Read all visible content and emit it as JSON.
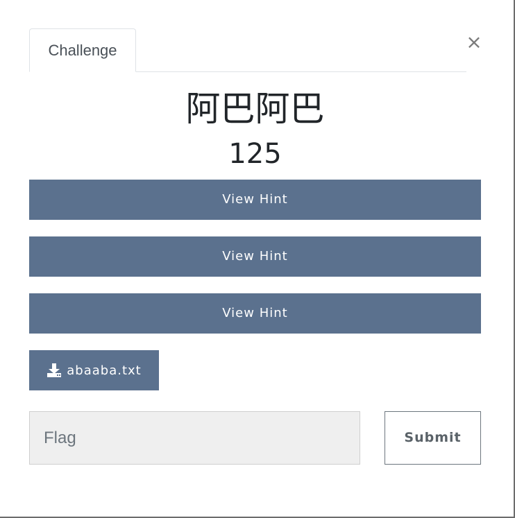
{
  "modal": {
    "close_glyph": "×",
    "tab_label": "Challenge",
    "title": "阿巴阿巴",
    "value": "125"
  },
  "hints": [
    {
      "label": "View Hint"
    },
    {
      "label": "View Hint"
    },
    {
      "label": "View Hint"
    }
  ],
  "file": {
    "icon": "download-icon",
    "name": "abaaba.txt"
  },
  "flag_form": {
    "placeholder": "Flag",
    "value": "",
    "submit_label": "Submit"
  },
  "colors": {
    "button_bg": "#5b718e",
    "button_text": "#ffffff",
    "input_bg": "#efefef"
  }
}
